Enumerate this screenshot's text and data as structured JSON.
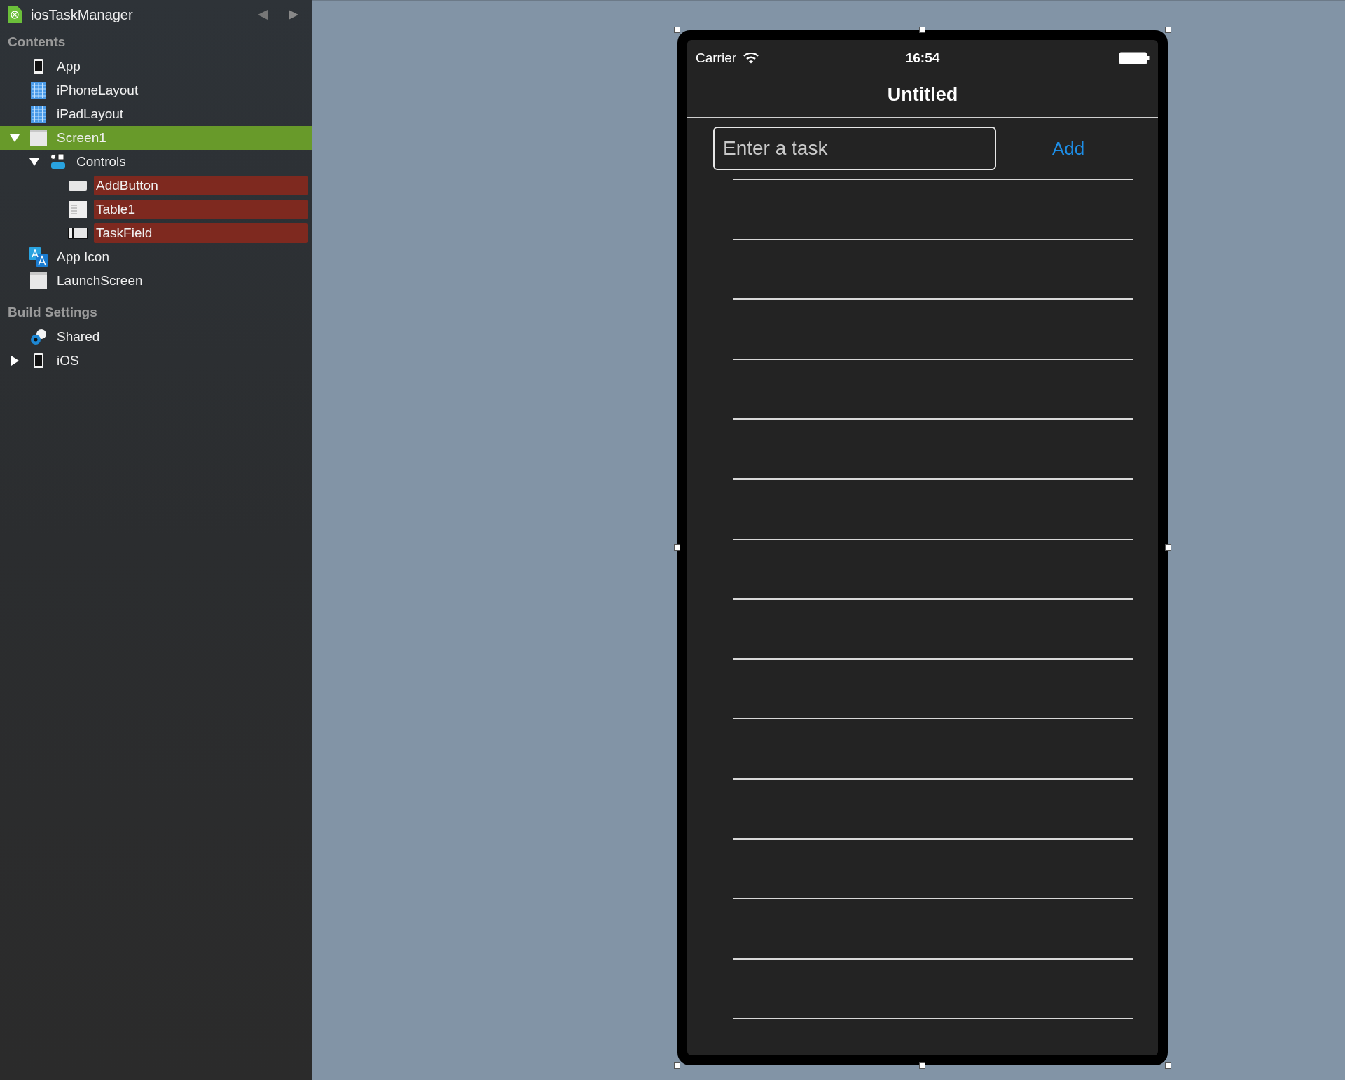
{
  "sidebar": {
    "project": {
      "title": "iosTaskManager"
    },
    "sections": [
      {
        "heading": "Contents",
        "items": [
          {
            "label": "App",
            "kind": "device",
            "selected": false
          },
          {
            "label": "iPhoneLayout",
            "kind": "layout",
            "selected": false
          },
          {
            "label": "iPadLayout",
            "kind": "layout",
            "selected": false
          },
          {
            "label": "Screen1",
            "kind": "screen",
            "selected": true,
            "expanded": true,
            "children": [
              {
                "label": "Controls",
                "kind": "controls",
                "selected": false,
                "expanded": true,
                "children": [
                  {
                    "label": "AddButton",
                    "kind": "button",
                    "selected": false,
                    "flagged": true
                  },
                  {
                    "label": "Table1",
                    "kind": "table",
                    "selected": false,
                    "flagged": true
                  },
                  {
                    "label": "TaskField",
                    "kind": "field",
                    "selected": false,
                    "flagged": true
                  }
                ]
              }
            ]
          },
          {
            "label": "App Icon",
            "kind": "appicon",
            "selected": false
          },
          {
            "label": "LaunchScreen",
            "kind": "screen",
            "selected": false
          }
        ]
      },
      {
        "heading": "Build Settings",
        "items": [
          {
            "label": "Shared",
            "kind": "shared",
            "selected": false
          },
          {
            "label": "iOS",
            "kind": "device",
            "selected": false,
            "expanded": false
          }
        ]
      }
    ]
  },
  "phone": {
    "status_bar": {
      "carrier": "Carrier",
      "time": "16:54"
    },
    "nav_title": "Untitled",
    "task_field": {
      "placeholder": "Enter a task"
    },
    "add_button": "Add"
  }
}
